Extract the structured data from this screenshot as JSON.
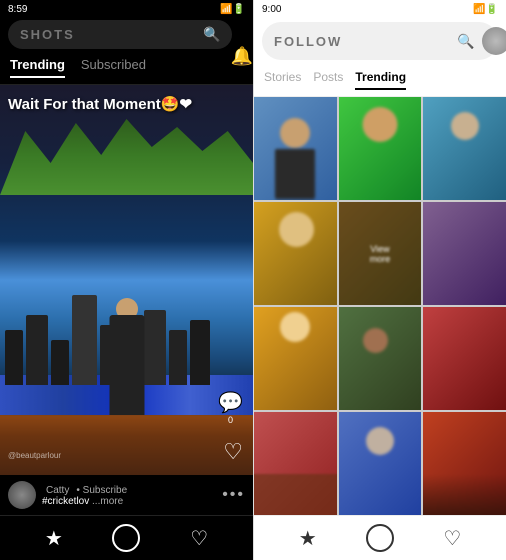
{
  "left": {
    "status_bar": {
      "time": "8:59",
      "icons": "status-icons"
    },
    "search": {
      "placeholder": "SHOTS",
      "search_icon": "🔍",
      "bell_icon": "🔔"
    },
    "tabs": [
      {
        "label": "Trending",
        "active": true
      },
      {
        "label": "Subscribed",
        "active": false
      }
    ],
    "video": {
      "overlay_text": "Wait For that Moment🤩❤",
      "watermark": "@beautparlour",
      "heart_icon": "♡",
      "comment_icon": "💬",
      "comment_count": "0"
    },
    "bottom_info": {
      "username": "Catty",
      "subscribe_label": "• Subscribe",
      "hashtag": "#cricketlov",
      "more_label": "...more",
      "dots": "•••"
    },
    "nav": [
      {
        "icon": "★",
        "label": "home-icon",
        "active": true
      },
      {
        "icon": "○",
        "label": "circle-icon",
        "active": false
      },
      {
        "icon": "♡",
        "label": "heart-icon",
        "active": false
      }
    ]
  },
  "right": {
    "status_bar": {
      "time": "9:00",
      "icons": "status-icons"
    },
    "search": {
      "placeholder": "FOLLOW",
      "search_icon": "🔍"
    },
    "tabs": [
      {
        "label": "Stories",
        "active": false
      },
      {
        "label": "Posts",
        "active": false
      },
      {
        "label": "Trending",
        "active": true
      }
    ],
    "grid": {
      "items": [
        {
          "id": 1,
          "color": "gi-1"
        },
        {
          "id": 2,
          "color": "gi-2"
        },
        {
          "id": 3,
          "color": "gi-3"
        },
        {
          "id": 4,
          "color": "gi-4"
        },
        {
          "id": 5,
          "color": "gi-5"
        },
        {
          "id": 6,
          "color": "gi-6"
        },
        {
          "id": 7,
          "color": "gi-7"
        },
        {
          "id": 8,
          "color": "gi-8"
        },
        {
          "id": 9,
          "color": "gi-9"
        },
        {
          "id": 10,
          "color": "gi-10"
        },
        {
          "id": 11,
          "color": "gi-11"
        },
        {
          "id": 12,
          "color": "gi-12"
        }
      ]
    },
    "nav": [
      {
        "icon": "★",
        "label": "home-icon",
        "active": false
      },
      {
        "icon": "○",
        "label": "circle-icon",
        "active": false
      },
      {
        "icon": "♡",
        "label": "heart-icon",
        "active": false
      }
    ]
  }
}
